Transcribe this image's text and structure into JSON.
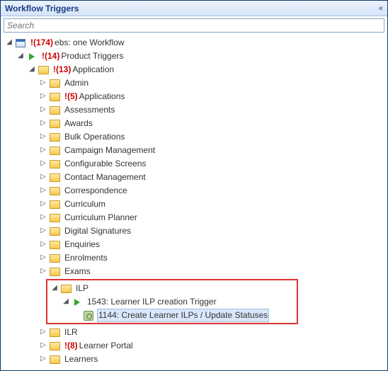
{
  "panel": {
    "title": "Workflow Triggers",
    "collapse_glyph": "«"
  },
  "search": {
    "placeholder": "Search"
  },
  "root": {
    "count": "!(174)",
    "label": "ebs: one Workflow"
  },
  "product": {
    "count": "!(14)",
    "label": "Product Triggers"
  },
  "application": {
    "count": "!(13)",
    "label": "Application"
  },
  "folders": [
    {
      "label": "Admin"
    },
    {
      "count": "!(5)",
      "label": "Applications"
    },
    {
      "label": "Assessments"
    },
    {
      "label": "Awards"
    },
    {
      "label": "Bulk Operations"
    },
    {
      "label": "Campaign Management"
    },
    {
      "label": "Configurable Screens"
    },
    {
      "label": "Contact Management"
    },
    {
      "label": "Correspondence"
    },
    {
      "label": "Curriculum"
    },
    {
      "label": "Curriculum Planner"
    },
    {
      "label": "Digital Signatures"
    },
    {
      "label": "Enquiries"
    },
    {
      "label": "Enrolments"
    },
    {
      "label": "Exams"
    }
  ],
  "ilp": {
    "folder_label": "ILP",
    "trigger_label": "1543: Learner ILP creation Trigger",
    "process_label": "1144: Create Learner ILPs / Update Statuses"
  },
  "after": [
    {
      "label": "ILR"
    },
    {
      "count": "!(8)",
      "label": "Learner Portal"
    },
    {
      "label": "Learners"
    }
  ]
}
